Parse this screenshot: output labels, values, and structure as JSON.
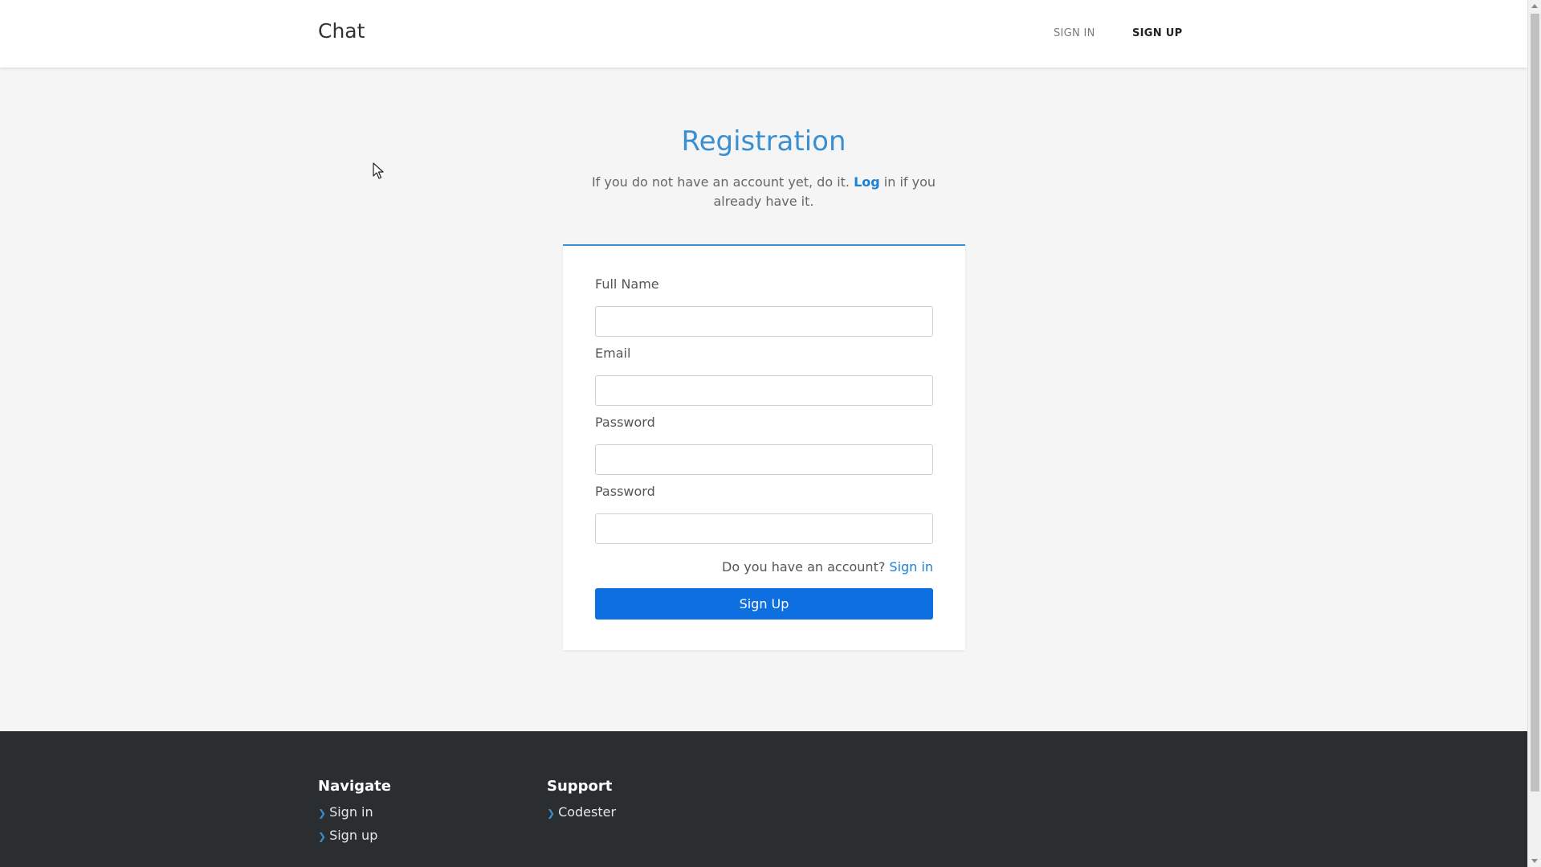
{
  "header": {
    "brand": "Chat",
    "nav": {
      "sign_in": "SIGN IN",
      "sign_up": "SIGN UP"
    }
  },
  "registration": {
    "title": "Registration",
    "intro_before": "If you do not have an account yet, do it. ",
    "intro_link": "Log",
    "intro_after": " in if you already have it.",
    "fields": {
      "full_name": {
        "label": "Full Name",
        "value": "",
        "placeholder": ""
      },
      "email": {
        "label": "Email",
        "value": "",
        "placeholder": ""
      },
      "password": {
        "label": "Password",
        "value": "",
        "placeholder": ""
      },
      "password_confirm": {
        "label": "Password",
        "value": "",
        "placeholder": ""
      }
    },
    "account_question": "Do you have an account? ",
    "account_link": "Sign in",
    "submit_label": "Sign Up"
  },
  "footer": {
    "navigate": {
      "title": "Navigate",
      "links": [
        "Sign in",
        "Sign up"
      ]
    },
    "support": {
      "title": "Support",
      "links": [
        "Codester"
      ]
    }
  },
  "colors": {
    "accent": "#3a8fd0",
    "button": "#0d6fe0",
    "footer_bg": "#2b2e31",
    "page_bg": "#f5f5f5"
  }
}
